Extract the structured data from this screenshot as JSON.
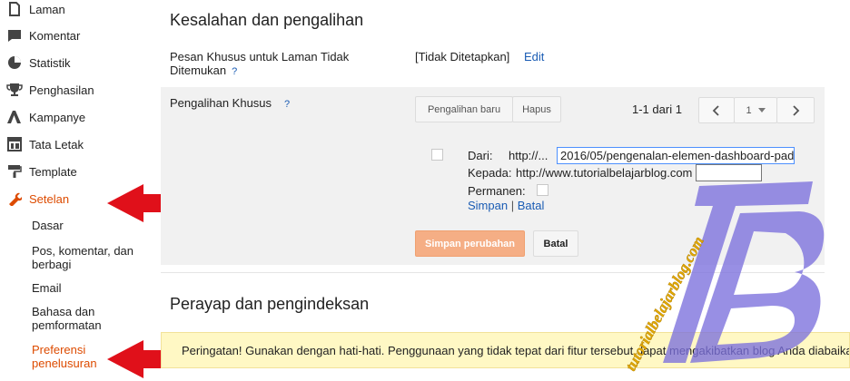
{
  "sidebar": {
    "items": [
      {
        "label": "Laman",
        "icon": "page-icon"
      },
      {
        "label": "Komentar",
        "icon": "comment-icon"
      },
      {
        "label": "Statistik",
        "icon": "pie-chart-icon"
      },
      {
        "label": "Penghasilan",
        "icon": "trophy-icon"
      },
      {
        "label": "Kampanye",
        "icon": "adwords-icon"
      },
      {
        "label": "Tata Letak",
        "icon": "layout-icon"
      },
      {
        "label": "Template",
        "icon": "paint-roller-icon"
      },
      {
        "label": "Setelan",
        "icon": "wrench-icon"
      }
    ],
    "subitems": [
      {
        "label": "Dasar"
      },
      {
        "label": "Pos, komentar, dan berbagi"
      },
      {
        "label": "Email"
      },
      {
        "label": "Bahasa dan pemformatan"
      },
      {
        "label": "Preferensi penelusuran"
      }
    ]
  },
  "main": {
    "section1_title": "Kesalahan dan pengalihan",
    "notfound_label": "Pesan Khusus untuk Laman Tidak Ditemukan",
    "notfound_help": "?",
    "notfound_value": "[Tidak Ditetapkan]",
    "notfound_edit": "Edit",
    "redirect_label": "Pengalihan Khusus",
    "redirect_help": "?",
    "new_redirect_button": "Pengalihan baru",
    "delete_button": "Hapus",
    "pagination_text": "1-1 dari 1",
    "page_select": "1",
    "from_label": "Dari:",
    "from_prefix": "http://...",
    "from_value": "2016/05/pengenalan-elemen-dashboard-pad",
    "to_label": "Kepada:",
    "to_prefix": "http://www.tutorialbelajarblog.com",
    "to_value": "",
    "permanent_label": "Permanen:",
    "save_link": "Simpan",
    "separator": "|",
    "cancel_link": "Batal",
    "save_changes_button": "Simpan perubahan",
    "cancel_button": "Batal",
    "section2_title": "Perayap dan pengindeksan",
    "warning_text": "Peringatan! Gunakan dengan hati-hati. Penggunaan yang tidak tepat dari fitur tersebut dapat mengakibatkan blog Anda diabaika",
    "watermark_text": "tutorialbelajarblog.com"
  },
  "colors": {
    "accent": "#dd4b00",
    "arrow": "#e0101a",
    "link": "#1a5cb4",
    "watermark": "#7b6fdc"
  }
}
